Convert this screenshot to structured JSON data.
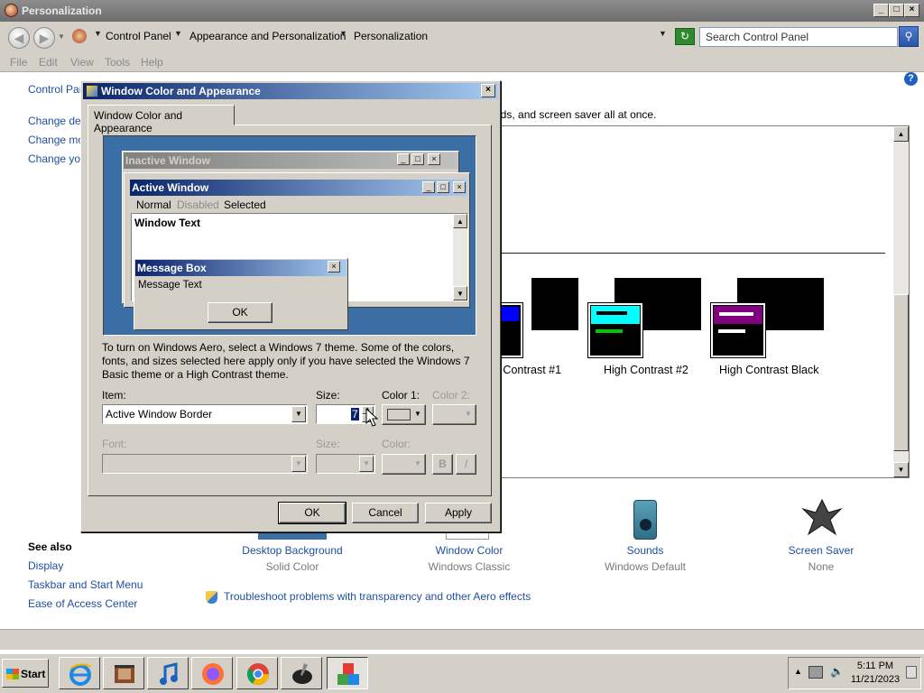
{
  "window": {
    "title": "Personalization",
    "caption_buttons": [
      "_",
      "□",
      "×"
    ]
  },
  "address": {
    "breadcrumbs": [
      "Control Panel",
      "Appearance and Personalization",
      "Personalization"
    ],
    "search_placeholder": "Search Control Panel"
  },
  "menu": [
    "File",
    "Edit",
    "View",
    "Tools",
    "Help"
  ],
  "sidebar": {
    "home": "Control Pan",
    "tasks": [
      "Change des",
      "Change mou",
      "Change you"
    ],
    "see_also_heading": "See also",
    "see_also": [
      "Display",
      "Taskbar and Start Menu",
      "Ease of Access Center"
    ]
  },
  "content": {
    "intro_fragment": "nds, and screen saver all at once.",
    "themes": [
      {
        "label": "h Contrast #1",
        "accent": "#0000ff"
      },
      {
        "label": "High Contrast #2",
        "accent": "#00ffff"
      },
      {
        "label": "High Contrast Black",
        "accent": "#800080"
      }
    ],
    "bottom_items": [
      {
        "title": "Desktop Background",
        "subtitle": "Solid Color"
      },
      {
        "title": "Window Color",
        "subtitle": "Windows Classic"
      },
      {
        "title": "Sounds",
        "subtitle": "Windows Default"
      },
      {
        "title": "Screen Saver",
        "subtitle": "None"
      }
    ],
    "troubleshoot": "Troubleshoot problems with transparency and other Aero effects"
  },
  "dialog": {
    "title": "Window Color and Appearance",
    "tab": "Window Color and Appearance",
    "preview": {
      "inactive_title": "Inactive Window",
      "active_title": "Active Window",
      "menu": [
        "Normal",
        "Disabled",
        "Selected"
      ],
      "window_text": "Window Text",
      "msgbox_title": "Message Box",
      "msgbox_text": "Message Text",
      "msgbox_ok": "OK"
    },
    "info": "To turn on Windows Aero, select a Windows 7 theme.  Some of the colors, fonts, and sizes selected here apply only if you have selected the Windows 7 Basic theme or a High Contrast theme.",
    "labels": {
      "item": "Item:",
      "size": "Size:",
      "color1": "Color 1:",
      "color2": "Color 2:",
      "font": "Font:",
      "font_size": "Size:",
      "font_color": "Color:"
    },
    "item_value": "Active Window Border",
    "size_value": "7",
    "bold_label": "B",
    "italic_label": "I",
    "buttons": {
      "ok": "OK",
      "cancel": "Cancel",
      "apply": "Apply"
    }
  },
  "taskbar": {
    "start": "Start",
    "apps": [
      "internet-explorer",
      "film",
      "music",
      "firefox",
      "chrome",
      "ink",
      "abc-blocks"
    ],
    "time": "5:11 PM",
    "date": "11/21/2023"
  }
}
